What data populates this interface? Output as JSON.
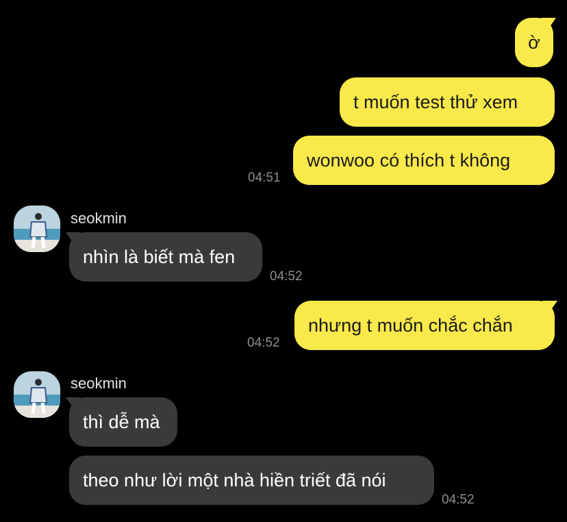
{
  "messages": {
    "m1": "ờ",
    "m2": "t muốn test thử xem",
    "m3": "wonwoo có thích t không",
    "t1": "04:51",
    "sender1": "seokmin",
    "m4": "nhìn là biết mà fen",
    "t2": "04:52",
    "m5": "nhưng t muốn chắc chắn",
    "t3": "04:52",
    "sender2": "seokmin",
    "m6": "thì dễ mà",
    "m7": "theo như lời một nhà hiền triết đã nói",
    "t4": "04:52"
  },
  "colors": {
    "background": "#000000",
    "outgoing_bubble": "#fae94a",
    "incoming_bubble": "#3a3a3c",
    "timestamp": "#8e8e93"
  },
  "icons": {
    "avatar": "avatar-photo-icon"
  }
}
